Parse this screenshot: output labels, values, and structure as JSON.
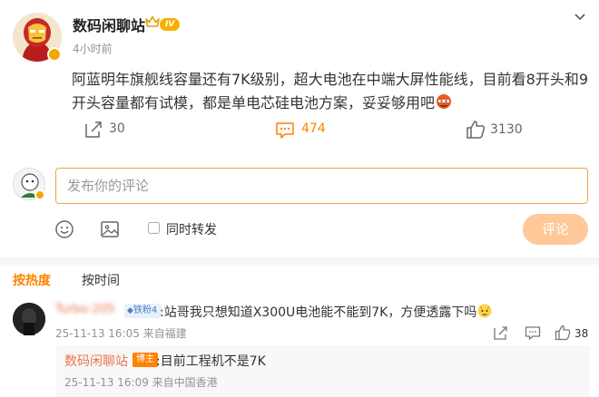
{
  "post": {
    "author": "数码闲聊站",
    "level_badge": "IV",
    "time": "4小时前",
    "text_line1": "阿蓝明年旗舰线容量还有7K级别，超大电池在中端大屏性能线，目前看8开头和9",
    "text_line2": "开头容量都有试模，都是单电芯硅电池方案，妥妥够用吧",
    "repost_count": "30",
    "comment_count": "474",
    "like_count": "3130"
  },
  "comment_input": {
    "placeholder": "发布你的评论",
    "repost_option": "同时转发",
    "submit_label": "评论"
  },
  "sort_tabs": {
    "hot": "按热度",
    "time": "按时间"
  },
  "comments": [
    {
      "user": "Turbo-205",
      "fan_badge": "铁粉4",
      "text": ":站哥我只想知道X300U电池能不能到7K，方便透露下吗",
      "meta": "25-11-13 16:05 来自福建",
      "like_count": "38",
      "reply": {
        "user": "数码闲聊站",
        "badge": "博主",
        "text": ":目前工程机不是7K",
        "meta": "25-11-13 16:09 来自中国香港"
      }
    }
  ],
  "colors": {
    "accent": "#ff8200",
    "username": "#eb7350",
    "input_border": "#f0a44a",
    "submit_disabled": "#ffc899"
  }
}
